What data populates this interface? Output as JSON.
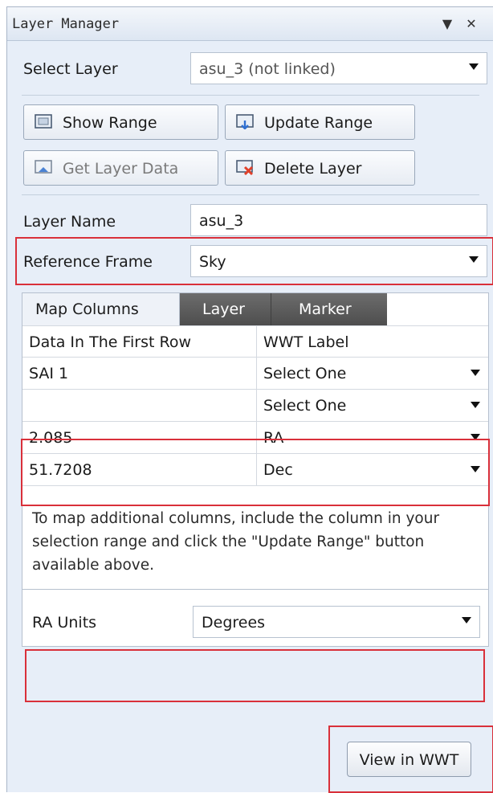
{
  "panel": {
    "title": "Layer Manager",
    "dropdown_icon": "▼",
    "close_icon": "✕"
  },
  "select_layer": {
    "label": "Select Layer",
    "value": "asu_3 (not linked)"
  },
  "buttons": {
    "show_range": "Show Range",
    "update_range": "Update Range",
    "get_layer_data": "Get Layer Data",
    "delete_layer": "Delete Layer"
  },
  "layer_name": {
    "label": "Layer Name",
    "value": "asu_3"
  },
  "reference_frame": {
    "label": "Reference Frame",
    "value": "Sky"
  },
  "tabs": [
    {
      "label": "Map Columns"
    },
    {
      "label": "Layer"
    },
    {
      "label": "Marker"
    }
  ],
  "columns_grid": {
    "headers": [
      "Data In The First Row",
      "WWT Label"
    ],
    "rows": [
      {
        "data": "SAI 1",
        "label": "Select One"
      },
      {
        "data": "",
        "label": "Select One"
      },
      {
        "data": "2.085",
        "label": "RA"
      },
      {
        "data": "51.7208",
        "label": "Dec"
      }
    ]
  },
  "hint_text": "To map additional columns, include the column in your selection range and click the \"Update Range\" button available above.",
  "ra_units": {
    "label": "RA Units",
    "value": "Degrees"
  },
  "view_button": "View in WWT",
  "colors": {
    "highlight": "#d9303a",
    "panel_bg": "#e7eef8",
    "tab_dark": "#5a5a5a"
  }
}
